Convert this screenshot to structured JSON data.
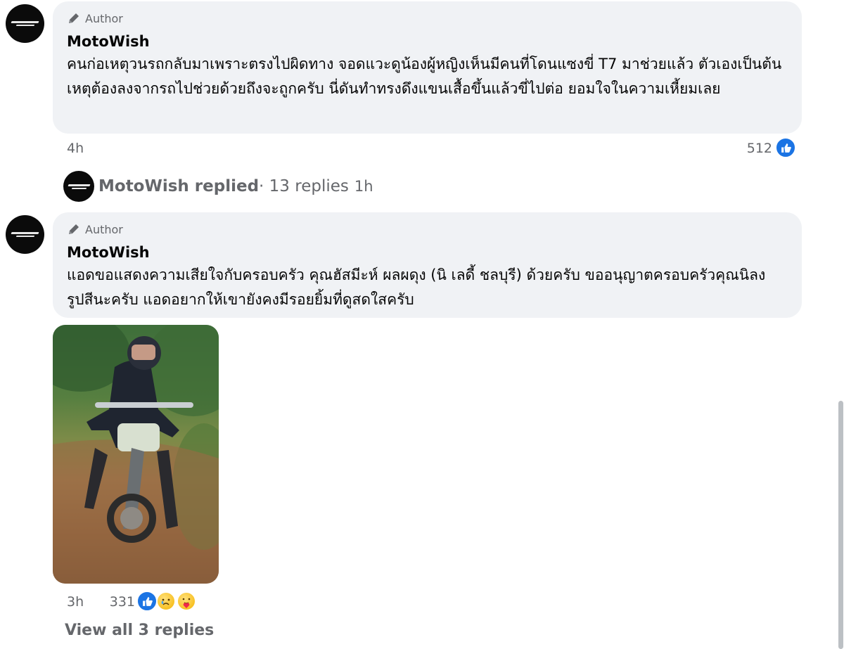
{
  "comments": [
    {
      "badge": "Author",
      "name": "MotoWish",
      "text": "คนก่อเหตุวนรถกลับมาเพราะตรงไปผิดทาง จอดแวะดูน้องผู้หญิงเห็นมีคนที่โดนแซงขี่ T7 มาช่วยแล้ว ตัวเองเป็นต้นเหตุต้องลงจากรถไปช่วยด้วยถึงจะถูกครับ นี่ดันทำทรงดึงแขนเสื้อขึ้นแล้วขี่ไปต่อ ยอมใจในความเหี้ยมเลย",
      "time": "4h",
      "reactions": "512"
    },
    {
      "badge": "Author",
      "name": "MotoWish",
      "text": "แอดขอแสดงความเสียใจกับครอบครัว คุณฮัสมีะห์ ผลผดุง (นิ เลดี้ ชลบุรี) ด้วยครับ ขออนุญาตครอบครัวคุณนิลงรูปสีนะครับ แอดอยากให้เขายังคงมีรอยยิ้มที่ดูสดใสครับ",
      "time": "3h",
      "reactions": "331"
    }
  ],
  "reply_summary": {
    "label": "MotoWish replied",
    "count": " · 13 replies",
    "time": "1h"
  },
  "view_all": "View all 3 replies",
  "colors": {
    "bubble": "#f0f2f5",
    "secondary_text": "#65676b",
    "like_blue": "#1b74e4"
  },
  "icons": {
    "badge": "pencil-icon",
    "like": "thumbs-up-icon",
    "care": "care-emoji-icon",
    "sad": "sad-emoji-icon"
  }
}
